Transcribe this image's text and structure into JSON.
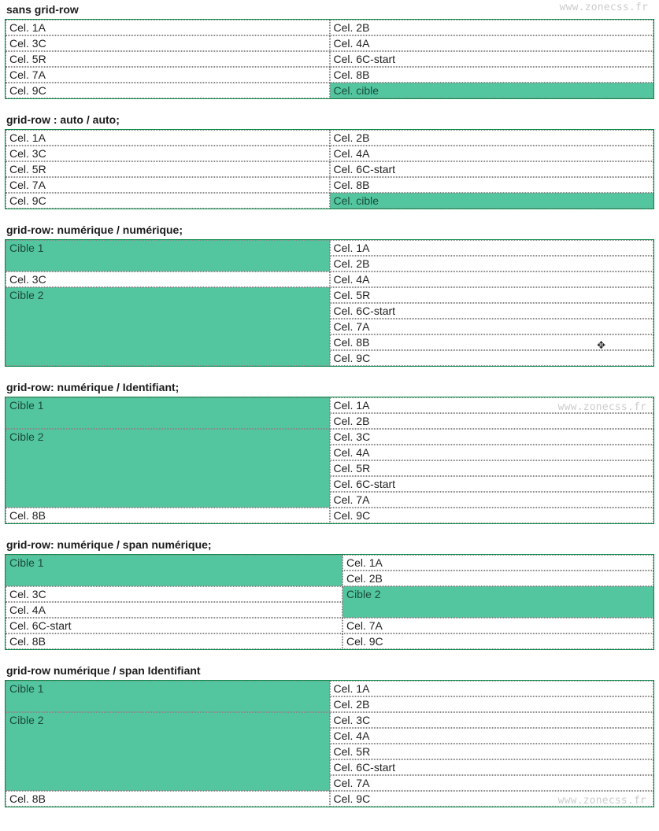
{
  "wm": "www.zonecss.fr",
  "sections": [
    {
      "id": "s1",
      "title": "sans grid-row",
      "wm": true
    },
    {
      "id": "s2",
      "title": "grid-row : auto / auto;"
    },
    {
      "id": "s3",
      "title": "grid-row: numérique / numérique;"
    },
    {
      "id": "s4",
      "title": "grid-row: numérique / Identifiant;",
      "wm_in": true
    },
    {
      "id": "s5",
      "title": "grid-row: numérique / span numérique;"
    },
    {
      "id": "s6",
      "title": "grid-row numérique / span Identifiant",
      "wm_bottom": true
    }
  ],
  "labels": {
    "c1a": "Cel. 1A",
    "c2b": "Cel. 2B",
    "c3c": "Cel. 3C",
    "c4a": "Cel. 4A",
    "c5r": "Cel. 5R",
    "c6c": "Cel. 6C-start",
    "c7a": "Cel. 7A",
    "c8b": "Cel. 8B",
    "c9c": "Cel. 9C",
    "cible": "Cel. cible",
    "t1": "Cible 1",
    "t2": "Cible 2"
  }
}
